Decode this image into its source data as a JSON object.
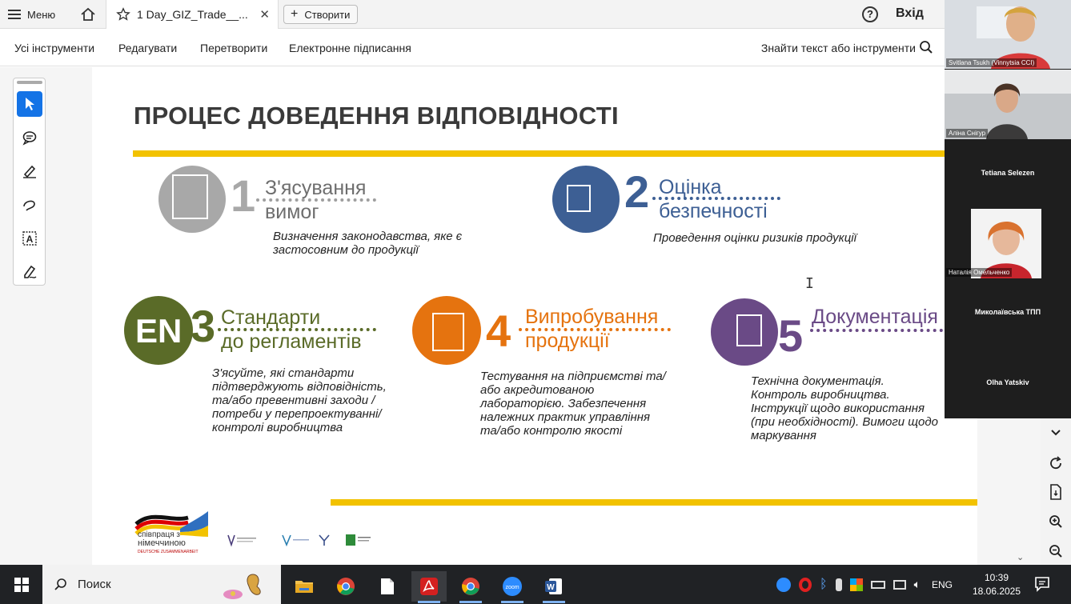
{
  "topbar": {
    "menu_label": "Меню",
    "tab_title": "1 Day_GIZ_Trade__...",
    "create_label": "Створити",
    "help_glyph": "?",
    "login_label": "Вхід"
  },
  "toolbar": {
    "tabs": [
      "Усі інструменти",
      "Редагувати",
      "Перетворити",
      "Електронне підписання"
    ],
    "find_label": "Знайти текст або інструменти"
  },
  "slide": {
    "title": "ПРОЦЕС ДОВЕДЕННЯ ВІДПОВІДНОСТІ",
    "steps": [
      {
        "number": "1",
        "title_line1": "З'ясування",
        "title_line2": "вимог",
        "color": "#9e9e9e",
        "desc": "Визначення законодавства, яке є застосовним до продукції"
      },
      {
        "number": "2",
        "title_line1": "Оцінка",
        "title_line2": "безпечності",
        "color": "#3d5f94",
        "desc": "Проведення оцінки ризиків продукції"
      },
      {
        "number": "3",
        "badge": "EN",
        "title_line1": "Стандарти",
        "title_line2": "до регламентів",
        "color": "#5a6b28",
        "desc": "З'ясуйте, які стандарти підтверджують відповідність, та/або превентивні заходи / потреби у перепроектуванні/ контролі виробництва"
      },
      {
        "number": "4",
        "title_line1": "Випробування",
        "title_line2": "продукції",
        "color": "#e5730f",
        "desc": "Тестування на підприємстві та/або акредитованою лабораторією. Забезпечення належних практик управління та/або контролю якості"
      },
      {
        "number": "5",
        "title_line1": "Документація",
        "title_line2": "",
        "color": "#6a4a86",
        "desc": "Технічна документація. Контроль виробництва. Інструкції щодо використання (при необхідності). Вимоги щодо маркування"
      }
    ],
    "coop_line1": "співпраця з",
    "coop_line2": "німеччиною",
    "coop_sub": "DEUTSCHE ZUSAMMENARBEIT",
    "accent_yellow": "#f2c200"
  },
  "participants": [
    {
      "name": "Svitlana Tsukh (Vinnytsia CCI)",
      "has_video": true
    },
    {
      "name": "Аліна Снігур",
      "has_video": true
    },
    {
      "name": "Tetiana Selezen",
      "has_video": false
    },
    {
      "name": "Наталія Омельченко",
      "has_video": true
    },
    {
      "name": "Миколаївська ТПП",
      "has_video": false
    },
    {
      "name": "Olha Yatskiv",
      "has_video": false
    }
  ],
  "taskbar": {
    "search_placeholder": "Поиск",
    "language": "ENG",
    "time": "10:39",
    "date": "18.06.2025",
    "zoom_label": "zoom"
  }
}
